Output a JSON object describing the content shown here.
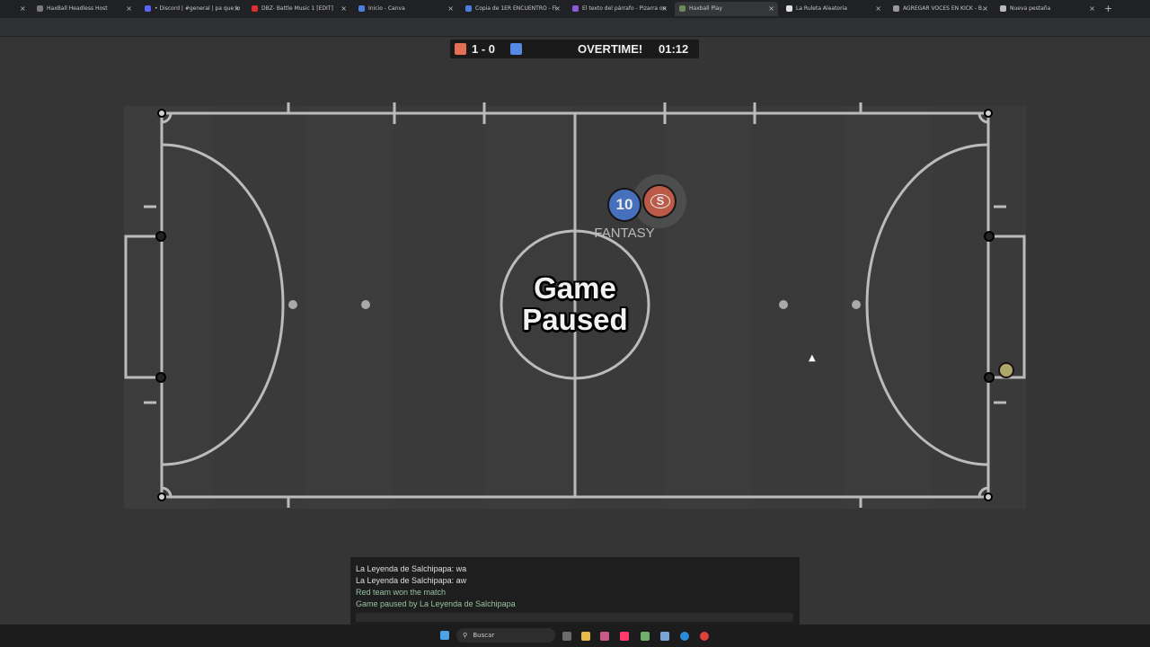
{
  "browser": {
    "tabs": [
      {
        "label": "HaxBall Headless Host",
        "color": "#7a7a7a"
      },
      {
        "label": "• Discord | #general | pa que lo",
        "color": "#5865f2"
      },
      {
        "label": "DBZ- Battle Music 1 [EDIT]",
        "color": "#e02f2f"
      },
      {
        "label": "Inicio - Canva",
        "color": "#4a7fe0"
      },
      {
        "label": "Copia de 1ER ENCUENTRO - Fi",
        "color": "#4a7fe0"
      },
      {
        "label": "El texto del párrafo - Pizarra on",
        "color": "#8a5cd8"
      },
      {
        "label": "Haxball Play",
        "color": "#6a8a5a"
      },
      {
        "label": "La Ruleta Aleatoria",
        "color": "#e0e0e0"
      },
      {
        "label": "AGREGAR VOCES EN KICK - B..",
        "color": "#999999"
      },
      {
        "label": "Nueva pestaña",
        "color": "#bbbbbb"
      }
    ],
    "active_tab_index": 6,
    "close_glyph": "×",
    "newtab_glyph": "+"
  },
  "scoreboard": {
    "score": "1 - 0",
    "status": "OVERTIME!",
    "clock": "01:12",
    "red_color": "#e56e56",
    "blue_color": "#5689e5"
  },
  "overlay": {
    "pause_line1": "Game",
    "pause_line2": "Paused"
  },
  "players": [
    {
      "number": "10",
      "name": "FANTASY",
      "team": "blue",
      "color": "#5689e5"
    },
    {
      "number": "S",
      "name": "",
      "team": "red",
      "color": "#e56e56"
    }
  ],
  "ball_color": "#d6cc82",
  "chat": {
    "messages": [
      {
        "text": "La Leyenda de Salchipapa: wa",
        "kind": "player"
      },
      {
        "text": "La Leyenda de Salchipapa: aw",
        "kind": "player"
      },
      {
        "text": "Red team won the match",
        "kind": "system"
      },
      {
        "text": "Game paused by La Leyenda de Salchipapa",
        "kind": "system"
      }
    ]
  },
  "taskbar": {
    "search_placeholder": "Buscar",
    "icons": [
      "windows-start-icon",
      "search-icon",
      "widgets-icon",
      "task-view-icon",
      "file-explorer-icon",
      "photos-icon",
      "tiktok-icon",
      "app-icon",
      "notepad-icon",
      "edge-icon",
      "chrome-icon"
    ]
  }
}
